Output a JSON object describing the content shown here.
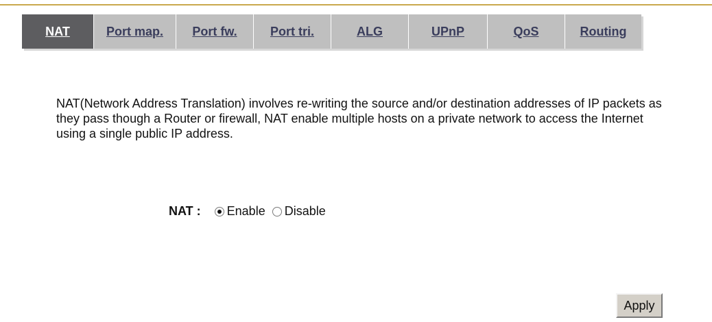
{
  "tabs": [
    {
      "label": "NAT",
      "active": true
    },
    {
      "label": "Port map.",
      "active": false
    },
    {
      "label": "Port fw.",
      "active": false
    },
    {
      "label": "Port tri.",
      "active": false
    },
    {
      "label": "ALG",
      "active": false
    },
    {
      "label": "UPnP",
      "active": false
    },
    {
      "label": "QoS",
      "active": false
    },
    {
      "label": "Routing",
      "active": false
    }
  ],
  "description": "NAT(Network Address Translation) involves re-writing the source and/or destination addresses of IP packets as they pass though a Router or firewall, NAT enable multiple hosts on a private network to access the Internet using a single public IP address.",
  "nat_setting": {
    "label": "NAT :",
    "options": [
      "Enable",
      "Disable"
    ],
    "selected": "Enable"
  },
  "apply_label": "Apply",
  "colors": {
    "accent_line": "#c9a84c",
    "tab_bar": "#bfbfbf",
    "tab_active": "#5d5d60",
    "tab_text": "#3a3d5c"
  }
}
